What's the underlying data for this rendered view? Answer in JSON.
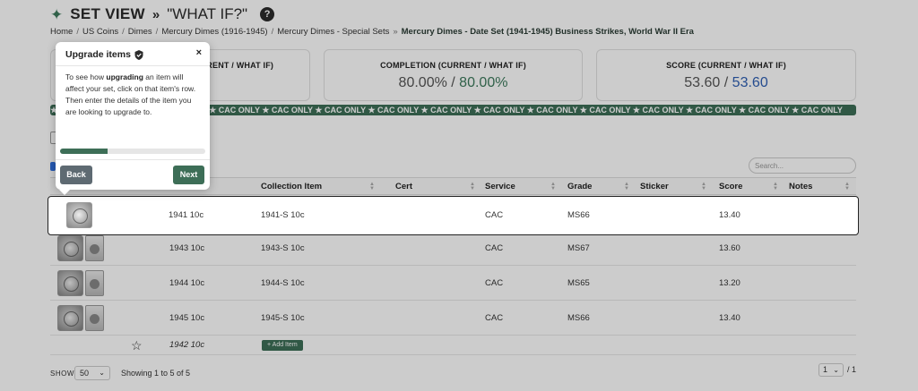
{
  "header": {
    "title": "SET VIEW",
    "separator": "»",
    "subtitle": "\"WHAT IF?\"",
    "help_label": "?"
  },
  "breadcrumb": {
    "items": [
      "Home",
      "US Coins",
      "Dimes",
      "Mercury Dimes (1916-1945)",
      "Mercury Dimes - Special Sets"
    ],
    "current": "Mercury Dimes - Date Set (1941-1945) Business Strikes, World War II Era"
  },
  "cards": {
    "first": {
      "label": "(CURRENT / WHAT IF)"
    },
    "completion": {
      "label": "COMPLETION (CURRENT / WHAT IF)",
      "current": "80.00%",
      "sep": "/",
      "whatif": "80.00%"
    },
    "score": {
      "label": "SCORE (CURRENT / WHAT IF)",
      "current": "53.60",
      "sep": "/",
      "whatif": "53.60"
    }
  },
  "cac_banner": "★ CAC ONLY ★ CAC ONLY ★ CAC ONLY ★ CAC ONLY ★ CAC ONLY ★ CAC ONLY ★ CAC ONLY ★ CAC ONLY ★ CAC ONLY ★ CAC ONLY ★ CAC ONLY ★ CAC ONLY ★ CAC ONLY ★ CAC ONLY ★ CAC ONLY",
  "search": {
    "placeholder": "Search..."
  },
  "table": {
    "columns": [
      "",
      "",
      "Collection Item",
      "Cert",
      "Service",
      "Grade",
      "Sticker",
      "Score",
      "Notes"
    ],
    "rows": [
      {
        "slot": "1941 10c",
        "item": "1941-S 10c",
        "cert": "",
        "service": "CAC",
        "grade": "MS66",
        "sticker": "",
        "score": "13.40",
        "notes": ""
      },
      {
        "slot": "1943 10c",
        "item": "1943-S 10c",
        "cert": "",
        "service": "CAC",
        "grade": "MS67",
        "sticker": "",
        "score": "13.60",
        "notes": ""
      },
      {
        "slot": "1944 10c",
        "item": "1944-S 10c",
        "cert": "",
        "service": "CAC",
        "grade": "MS65",
        "sticker": "",
        "score": "13.20",
        "notes": ""
      },
      {
        "slot": "1945 10c",
        "item": "1945-S 10c",
        "cert": "",
        "service": "CAC",
        "grade": "MS66",
        "sticker": "",
        "score": "13.40",
        "notes": ""
      }
    ],
    "empty_row": {
      "slot": "1942 10c",
      "add_label": "+ Add Item"
    }
  },
  "footer": {
    "show_label": "SHOW",
    "show_value": "50",
    "showing_text": "Showing 1 to 5 of 5",
    "page_value": "1",
    "page_total": "/ 1"
  },
  "popover": {
    "title": "Upgrade items",
    "close_label": "×",
    "body_pre": "To see how ",
    "body_bold": "upgrading",
    "body_post": " an item will affect your set, click on that item's row. Then enter the details of the item you are looking to upgrade to.",
    "progress": 0.33,
    "back_label": "Back",
    "next_label": "Next"
  },
  "colors": {
    "brand_green": "#3d6e57",
    "accent_blue": "#2f5fb3",
    "back_gray": "#5e6a72"
  }
}
